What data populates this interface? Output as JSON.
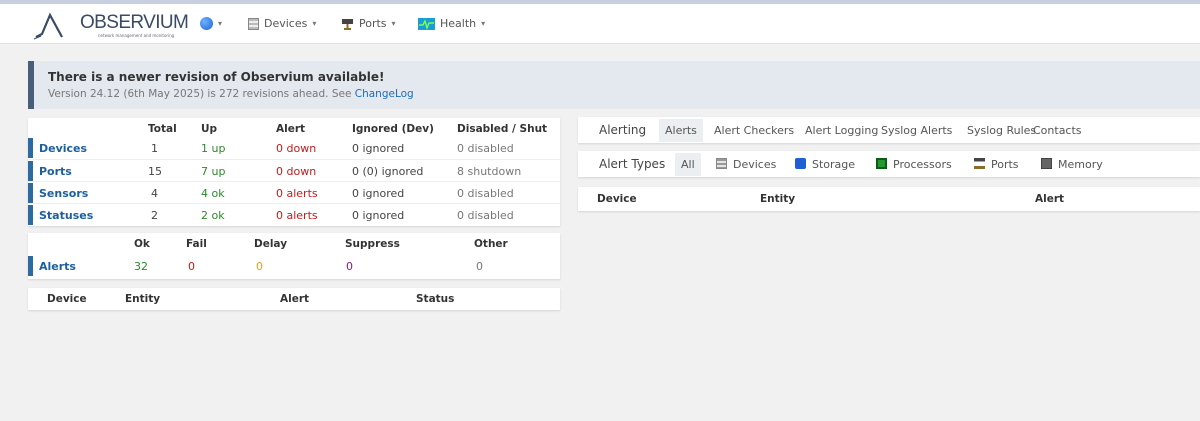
{
  "brand": {
    "name": "OBSERVIUM",
    "tagline": "network management and monitoring"
  },
  "nav": {
    "items": [
      {
        "label": "Devices",
        "icon": "devices-icon"
      },
      {
        "label": "Ports",
        "icon": "ports-icon"
      },
      {
        "label": "Health",
        "icon": "health-icon"
      }
    ],
    "globe_icon": "globe-icon",
    "caret": "▾"
  },
  "banner": {
    "title": "There is a newer revision of Observium available!",
    "text": "Version 24.12 (6th May 2025) is 272 revisions ahead. See ",
    "link": "ChangeLog"
  },
  "summary": {
    "headers": [
      "Total",
      "Up",
      "Alert",
      "Ignored (Dev)",
      "Disabled / Shut"
    ],
    "rows": [
      {
        "label": "Devices",
        "total": "1",
        "up": "1 up",
        "alert": "0 down",
        "ignored": "0 ignored",
        "disabled": "0 disabled"
      },
      {
        "label": "Ports",
        "total": "15",
        "up": "7 up",
        "alert": "0 down",
        "ignored": "0 (0) ignored",
        "disabled": "8 shutdown"
      },
      {
        "label": "Sensors",
        "total": "4",
        "up": "4 ok",
        "alert": "0 alerts",
        "ignored": "0 ignored",
        "disabled": "0 disabled"
      },
      {
        "label": "Statuses",
        "total": "2",
        "up": "2 ok",
        "alert": "0 alerts",
        "ignored": "0 ignored",
        "disabled": "0 disabled"
      }
    ]
  },
  "alerts_summary": {
    "headers": [
      "Ok",
      "Fail",
      "Delay",
      "Suppress",
      "Other"
    ],
    "row": {
      "label": "Alerts",
      "ok": "32",
      "fail": "0",
      "delay": "0",
      "suppress": "0",
      "other": "0"
    }
  },
  "alert_table_left": {
    "headers": [
      "Device",
      "Entity",
      "Alert",
      "Status"
    ]
  },
  "alerting_tabs": {
    "lead": "Alerting",
    "tabs": [
      "Alerts",
      "Alert Checkers",
      "Alert Logging",
      "Syslog Alerts",
      "Syslog Rules",
      "Contacts"
    ],
    "active": "Alerts"
  },
  "alert_types": {
    "lead": "Alert Types",
    "types": [
      {
        "label": "All",
        "icon": ""
      },
      {
        "label": "Devices",
        "icon": "devices-icon"
      },
      {
        "label": "Storage",
        "icon": "storage-icon"
      },
      {
        "label": "Processors",
        "icon": "processors-icon"
      },
      {
        "label": "Ports",
        "icon": "ports-icon"
      },
      {
        "label": "Memory",
        "icon": "memory-icon"
      }
    ],
    "active": "All"
  },
  "alert_table_right": {
    "headers": [
      "Device",
      "Entity",
      "Alert"
    ]
  },
  "colors": {
    "accent": "#2c6aa0",
    "ok_green": "#2a8a2a",
    "alert_red": "#c41b1b",
    "delay_orange": "#e69a22",
    "suppress_purple": "#8a1b7a",
    "banner_bg": "#e4e8ef"
  }
}
